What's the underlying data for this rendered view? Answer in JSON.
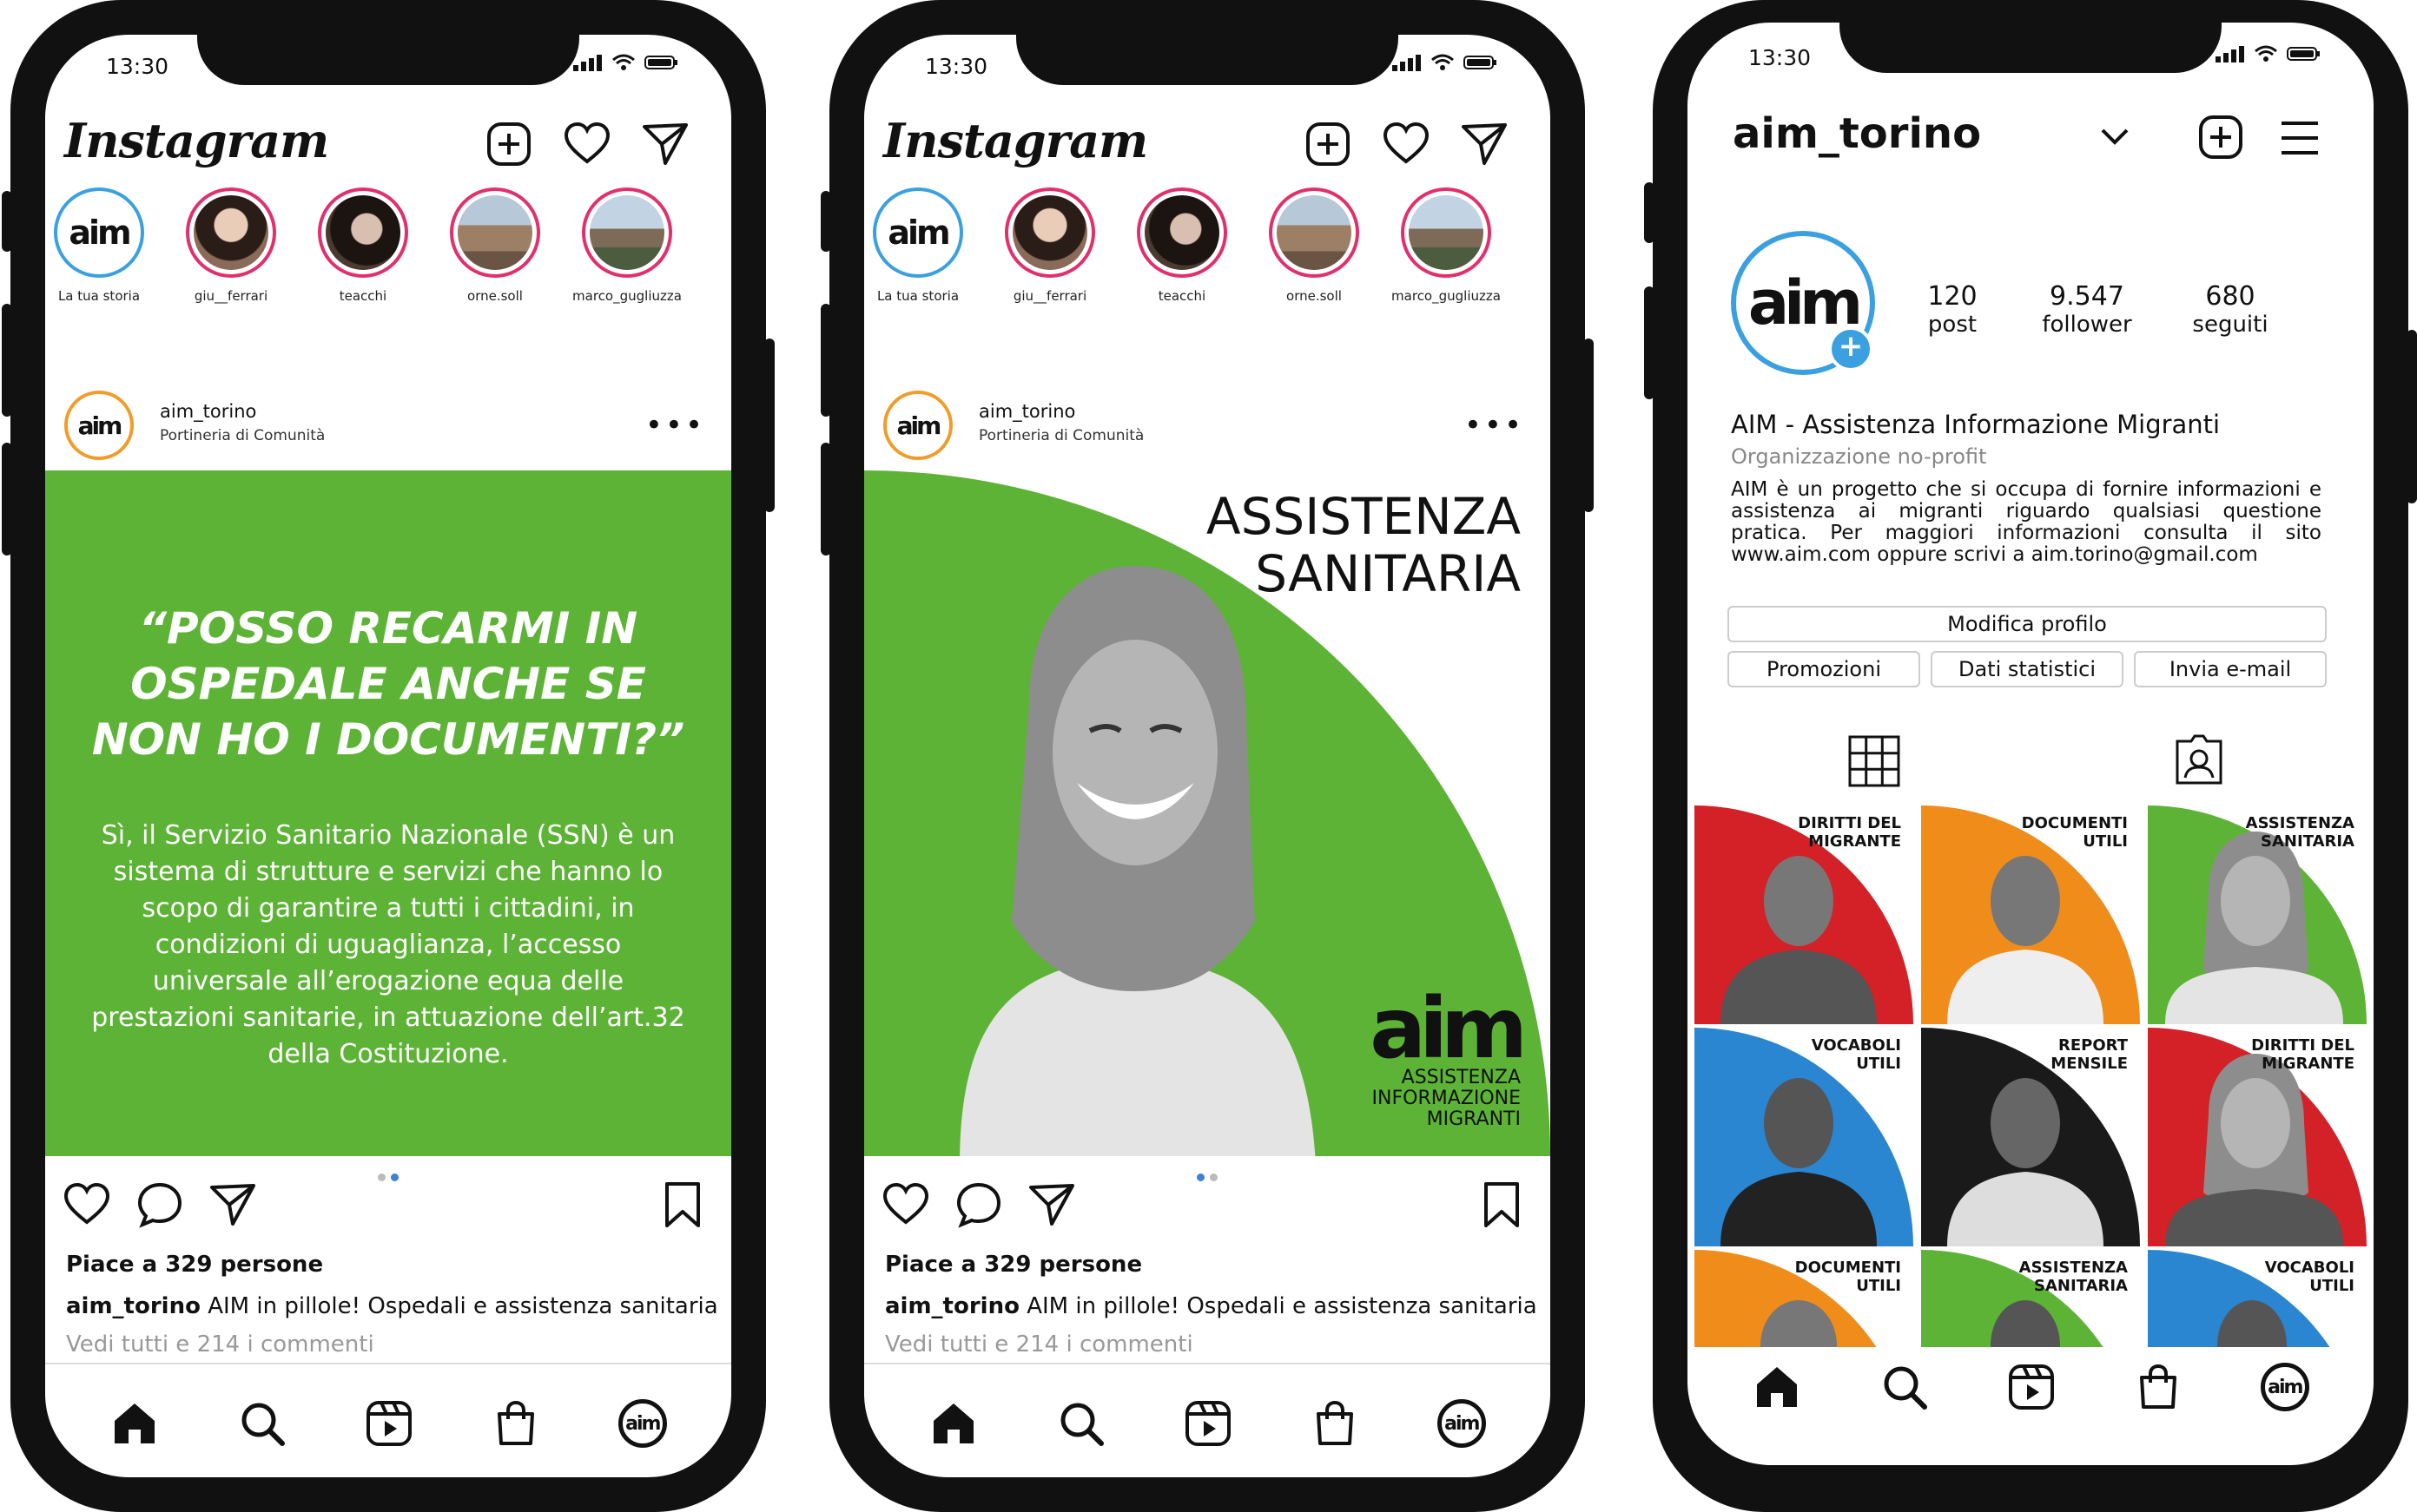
{
  "status": {
    "time": "13:30"
  },
  "feed": {
    "logo": "Instagram",
    "stories": [
      {
        "name": "La tua storia"
      },
      {
        "name": "giu__ferrari"
      },
      {
        "name": "teacchi"
      },
      {
        "name": "orne.soll"
      },
      {
        "name": "marco_gugliuzza"
      }
    ],
    "post": {
      "username": "aim_torino",
      "subtitle": "Portineria di Comunità",
      "likes": "Piace a 329 persone",
      "caption_user": "aim_torino",
      "caption_text": "AIM in pillole! Ospedali e assistenza sanitaria",
      "comments": "Vedi tutti e 214 i commenti"
    },
    "slide1": {
      "question": "“POSSO RECARMI IN OSPEDALE ANCHE SE NON HO I DOCUMENTI?”",
      "answer": "Sì, il Servizio Sanitario Nazionale (SSN) è un sistema di strutture e servizi che hanno lo scopo di garantire a tutti i cittadini, in condizioni di uguaglianza, l’accesso universale all’erogazione equa delle prestazioni sanitarie, in attuazione dell’art.32 della Costituzione."
    },
    "slide2": {
      "title_line1": "ASSISTENZA",
      "title_line2": "SANITARIA",
      "brand": "aim",
      "brand_line1": "ASSISTENZA",
      "brand_line2": "INFORMAZIONE",
      "brand_line3": "MIGRANTI"
    }
  },
  "profile": {
    "username": "aim_torino",
    "stats": [
      {
        "value": "120",
        "label": "post"
      },
      {
        "value": "9.547",
        "label": "follower"
      },
      {
        "value": "680",
        "label": "seguiti"
      }
    ],
    "name": "AIM - Assistenza Informazione Migranti",
    "category": "Organizzazione no-profit",
    "bio": "AIM è un progetto che si occupa di fornire informazioni e assistenza ai migranti riguardo qualsiasi questione pratica. Per maggiori informazioni consulta il sito www.aim.com oppure scrivi a aim.torino@gmail.com",
    "buttons": {
      "edit": "Modifica profilo",
      "promo": "Promozioni",
      "stats": "Dati statistici",
      "email": "Invia e-mail"
    },
    "grid": [
      {
        "label1": "DIRITTI DEL",
        "label2": "MIGRANTE",
        "color": "#d42027"
      },
      {
        "label1": "DOCUMENTI",
        "label2": "UTILI",
        "color": "#f08c1a"
      },
      {
        "label1": "ASSISTENZA",
        "label2": "SANITARIA",
        "color": "#5db336"
      },
      {
        "label1": "VOCABOLI",
        "label2": "UTILI",
        "color": "#2a86d1"
      },
      {
        "label1": "REPORT",
        "label2": "MENSILE",
        "color": "#1a1a1a"
      },
      {
        "label1": "DIRITTI DEL",
        "label2": "MIGRANTE",
        "color": "#d42027"
      },
      {
        "label1": "DOCUMENTI",
        "label2": "UTILI",
        "color": "#f08c1a"
      },
      {
        "label1": "ASSISTENZA",
        "label2": "SANITARIA",
        "color": "#5db336"
      },
      {
        "label1": "VOCABOLI",
        "label2": "UTILI",
        "color": "#2a86d1"
      }
    ]
  },
  "colors": {
    "green": "#5db336",
    "story_ring": "#e1306c",
    "own_ring": "#3ba0e0"
  },
  "icons": [
    "add-post-icon",
    "heart-icon",
    "send-icon",
    "comment-icon",
    "bookmark-icon",
    "home-icon",
    "search-icon",
    "reels-icon",
    "shop-icon",
    "grid-icon",
    "tagged-icon",
    "chevron-down-icon",
    "menu-icon"
  ]
}
